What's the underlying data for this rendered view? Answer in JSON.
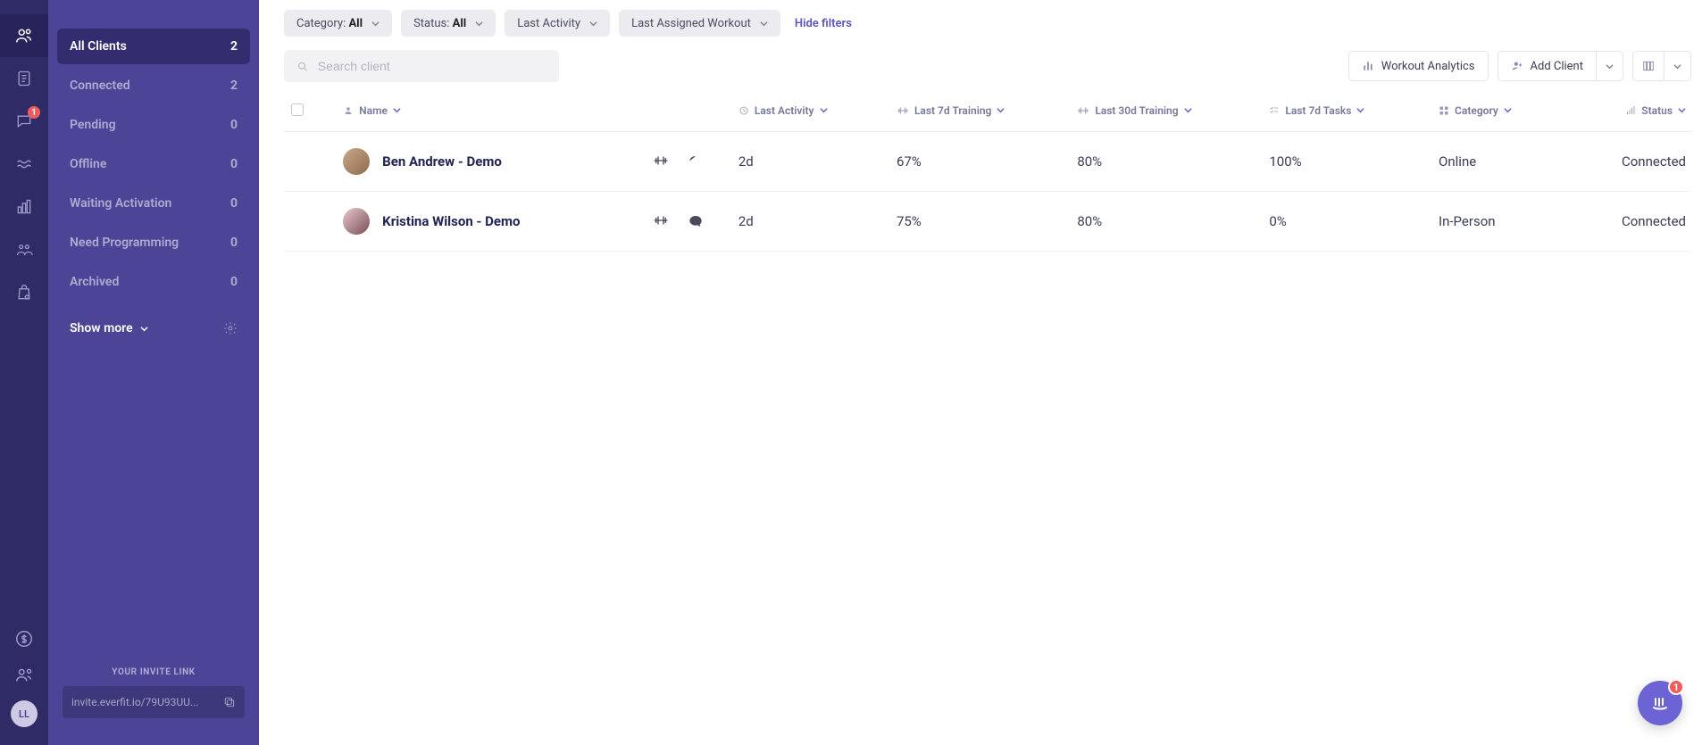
{
  "rail": {
    "message_badge": "1",
    "user_initials": "LL"
  },
  "sidebar": {
    "items": [
      {
        "label": "All Clients",
        "count": "2",
        "active": true
      },
      {
        "label": "Connected",
        "count": "2",
        "active": false
      },
      {
        "label": "Pending",
        "count": "0",
        "active": false
      },
      {
        "label": "Offline",
        "count": "0",
        "active": false
      },
      {
        "label": "Waiting Activation",
        "count": "0",
        "active": false
      },
      {
        "label": "Need Programming",
        "count": "0",
        "active": false
      },
      {
        "label": "Archived",
        "count": "0",
        "active": false
      }
    ],
    "show_more": "Show more",
    "invite_header": "YOUR INVITE LINK",
    "invite_link": "invite.everfit.io/79U93UU..."
  },
  "filters": {
    "category_prefix": "Category: ",
    "category_value": "All",
    "status_prefix": "Status: ",
    "status_value": "All",
    "last_activity": "Last Activity",
    "last_assigned": "Last Assigned Workout",
    "hide": "Hide filters"
  },
  "toolbar": {
    "search_placeholder": "Search client",
    "workout_analytics": "Workout Analytics",
    "add_client": "Add Client"
  },
  "table": {
    "headers": {
      "name": "Name",
      "last_activity": "Last Activity",
      "last_7d_training": "Last 7d Training",
      "last_30d_training": "Last 30d Training",
      "last_7d_tasks": "Last 7d Tasks",
      "category": "Category",
      "status": "Status"
    },
    "rows": [
      {
        "name": "Ben Andrew - Demo",
        "last_activity": "2d",
        "t7": "67%",
        "t30": "80%",
        "tasks": "100%",
        "category": "Online",
        "status": "Connected"
      },
      {
        "name": "Kristina Wilson - Demo",
        "last_activity": "2d",
        "t7": "75%",
        "t30": "80%",
        "tasks": "0%",
        "category": "In-Person",
        "status": "Connected"
      }
    ]
  },
  "chat": {
    "badge": "1"
  }
}
